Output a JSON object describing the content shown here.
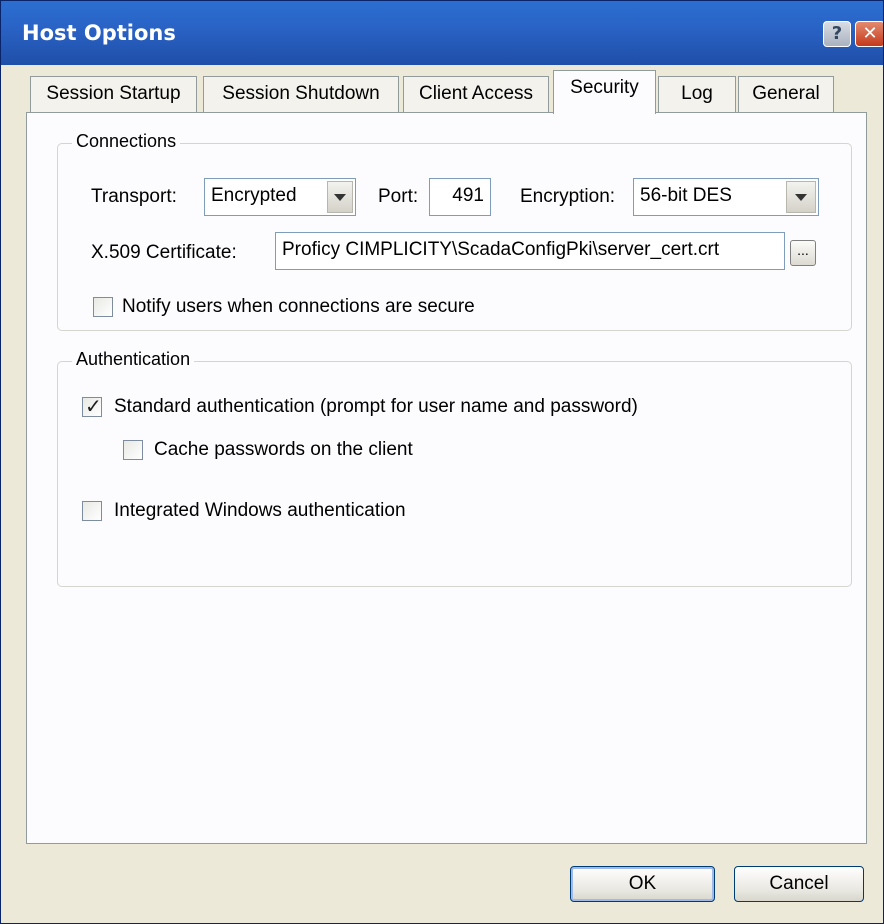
{
  "window": {
    "title": "Host Options",
    "help_glyph": "?",
    "close_glyph": "✕"
  },
  "tabs": [
    {
      "label": "Session Startup"
    },
    {
      "label": "Session Shutdown"
    },
    {
      "label": "Client Access"
    },
    {
      "label": "Security"
    },
    {
      "label": "Log"
    },
    {
      "label": "General"
    }
  ],
  "active_tab": "Security",
  "connections": {
    "legend": "Connections",
    "transport_label": "Transport:",
    "transport_value": "Encrypted",
    "port_label": "Port:",
    "port_value": "491",
    "encryption_label": "Encryption:",
    "encryption_value": "56-bit DES",
    "cert_label": "X.509 Certificate:",
    "cert_value": "Proficy CIMPLICITY\\ScadaConfigPki\\server_cert.crt",
    "browse_label": "...",
    "notify_label": "Notify users when connections are secure",
    "notify_checked": false
  },
  "authentication": {
    "legend": "Authentication",
    "standard_label": "Standard authentication (prompt for user name and password)",
    "standard_checked": true,
    "cache_label": "Cache passwords on the client",
    "cache_checked": false,
    "integrated_label": "Integrated Windows authentication",
    "integrated_checked": false,
    "check_glyph": "✓"
  },
  "buttons": {
    "ok": "OK",
    "cancel": "Cancel"
  },
  "colors": {
    "titlebar": "#2a63c6",
    "dialog_bg": "#ece9d8",
    "panel_bg": "#fcfcfe",
    "close_button": "#c5391b"
  }
}
